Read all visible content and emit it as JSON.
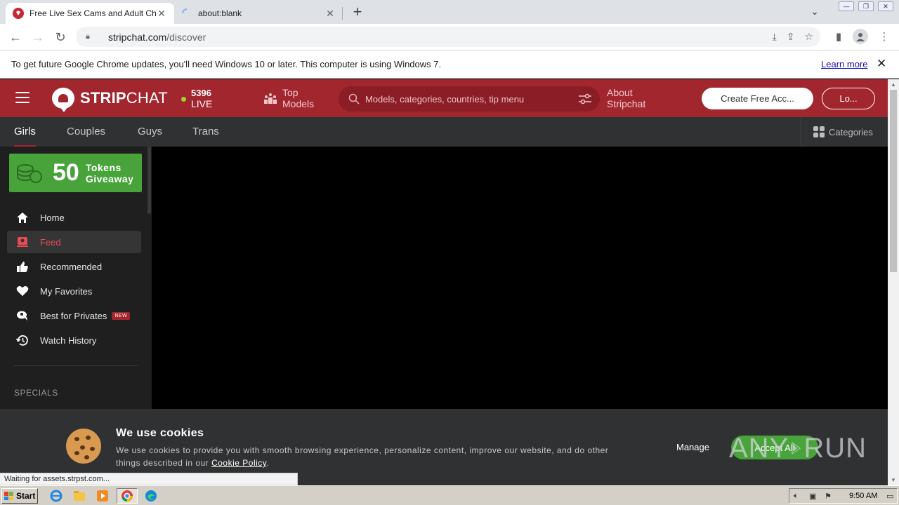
{
  "browser": {
    "tabs": [
      {
        "title": "Free Live Sex Cams and Adult Chat",
        "active": true
      },
      {
        "title": "about:blank",
        "active": false
      }
    ],
    "url_domain": "stripchat.com",
    "url_path": "/discover",
    "infobar_message": "To get future Google Chrome updates, you'll need Windows 10 or later. This computer is using Windows 7.",
    "infobar_link": "Learn more",
    "status_text": "Waiting for assets.strpst.com..."
  },
  "site": {
    "brand_bold": "STRIP",
    "brand_rest": "CHAT",
    "live_count": "5396",
    "live_label": "LIVE",
    "top_models_line1": "Top",
    "top_models_line2": "Models",
    "search_placeholder": "Models, categories, countries, tip menu",
    "about_line1": "About",
    "about_line2": "Stripchat",
    "create_account": "Create Free Acc...",
    "login": "Lo...",
    "categories_tabs": [
      "Girls",
      "Couples",
      "Guys",
      "Trans"
    ],
    "categories_button": "Categories",
    "accent_color": "#a2262e"
  },
  "sidebar": {
    "promo_number": "50",
    "promo_line1": "Tokens",
    "promo_line2": "Giveaway",
    "items": [
      {
        "label": "Home",
        "icon": "home-icon"
      },
      {
        "label": "Feed",
        "icon": "feed-icon",
        "active": true
      },
      {
        "label": "Recommended",
        "icon": "thumbs-up-icon"
      },
      {
        "label": "My Favorites",
        "icon": "heart-icon"
      },
      {
        "label": "Best for Privates",
        "icon": "private-chat-icon",
        "badge": "NEW"
      },
      {
        "label": "Watch History",
        "icon": "history-icon"
      }
    ],
    "section_label": "SPECIALS"
  },
  "cookie": {
    "title": "We use cookies",
    "text": "We use cookies to provide you with smooth browsing experience, personalize content, improve our website, and do other things described in our",
    "policy_link": "Cookie Policy",
    "manage": "Manage",
    "accept": "Accept All"
  },
  "watermark": {
    "left": "ANY",
    "right": "RUN"
  },
  "taskbar": {
    "start": "Start",
    "time": "9:50 AM"
  }
}
